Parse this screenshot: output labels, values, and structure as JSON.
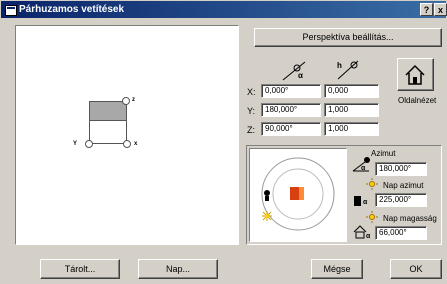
{
  "window": {
    "title": "Párhuzamos vetítések",
    "help_label": "?",
    "close_label": "x"
  },
  "preview": {
    "axis_z": "z",
    "axis_y": "Y",
    "axis_x": "x"
  },
  "perspective_button": "Perspektíva beállítás...",
  "coords": {
    "x_label": "X:",
    "y_label": "Y:",
    "z_label": "Z:",
    "x_angle": "0,000°",
    "y_angle": "180,000°",
    "z_angle": "90,000°",
    "x_scale": "0,000",
    "y_scale": "1,000",
    "z_scale": "1,000"
  },
  "side_view_label": "Oldalnézet",
  "sun": {
    "azimut_label": "Azimut",
    "azimut_value": "180,000°",
    "nap_azimut_label": "Nap azimut",
    "nap_azimut_value": "225,000°",
    "nap_magassag_label": "Nap magasság",
    "nap_magassag_value": "66,000°"
  },
  "buttons": {
    "stored": "Tárolt...",
    "sun": "Nap...",
    "cancel": "Mégse",
    "ok": "OK"
  }
}
